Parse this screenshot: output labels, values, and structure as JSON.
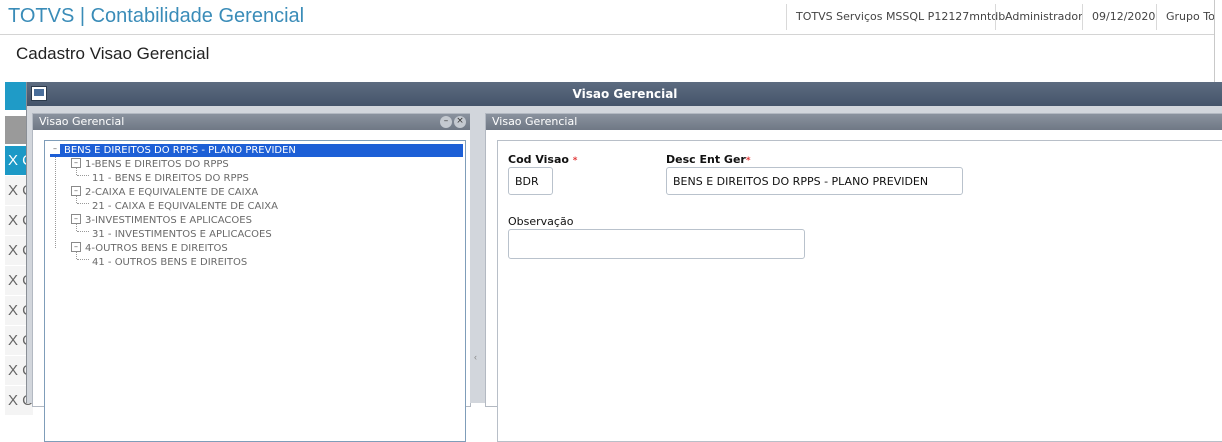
{
  "header": {
    "app_title": "TOTVS | Contabilidade Gerencial",
    "env": "TOTVS Serviços MSSQL P12127mntdb",
    "user": "Administrador",
    "date": "09/12/2020",
    "group": "Grupo Totvs"
  },
  "page": {
    "title": "Cadastro Visao Gerencial"
  },
  "background_rows": [
    "X C",
    "X C",
    "X C",
    "X C",
    "X C",
    "X C",
    "X C",
    "X C",
    "X C"
  ],
  "dialog": {
    "title": "Visao Gerencial",
    "left_panel": {
      "title": "Visao Gerencial",
      "tree": {
        "root": "BENS E DIREITOS DO RPPS - PLANO PREVIDEN",
        "items": [
          {
            "label": "1-BENS E DIREITOS DO RPPS",
            "child": "11 - BENS E DIREITOS DO RPPS"
          },
          {
            "label": "2-CAIXA E EQUIVALENTE DE CAIXA",
            "child": "21 - CAIXA E EQUIVALENTE DE CAIXA"
          },
          {
            "label": "3-INVESTIMENTOS E APLICACOES",
            "child": "31 - INVESTIMENTOS E APLICACOES"
          },
          {
            "label": "4-OUTROS BENS E DIREITOS",
            "child": "41 - OUTROS BENS E DIREITOS"
          }
        ]
      }
    },
    "right_panel": {
      "title": "Visao Gerencial",
      "cod_visao_label": "Cod Visao",
      "cod_visao_value": "BDR",
      "desc_label": "Desc Ent Ger",
      "desc_value": "BENS E DIREITOS DO RPPS - PLANO PREVIDEN",
      "obs_label": "Observação",
      "obs_value": ""
    }
  },
  "icons": {
    "minimize": "–",
    "close": "×",
    "collapse": "–",
    "splitter": "‹",
    "required": "*"
  },
  "colors": {
    "brand": "#3a8cb8",
    "accent": "#1c99c6",
    "selection": "#1d5fd6",
    "required": "#e23a3a"
  }
}
